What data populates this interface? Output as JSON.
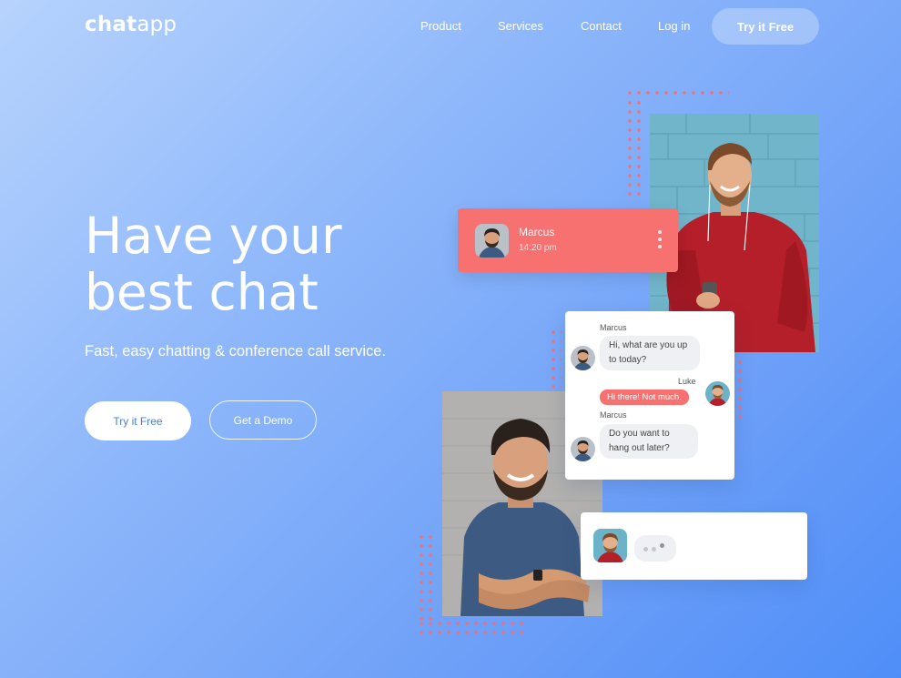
{
  "nav": {
    "logo_bold": "chat",
    "logo_light": "app",
    "links": [
      "Product",
      "Services",
      "Contact",
      "Log in"
    ],
    "cta_label": "Try it Free"
  },
  "hero": {
    "title_line1": "Have your",
    "title_line2": "best chat",
    "subtitle": "Fast, easy chatting & conference call service.",
    "primary_button": "Try it Free",
    "secondary_button": "Get a Demo"
  },
  "contact_card": {
    "name": "Marcus",
    "time": "14:20 pm"
  },
  "conversation": {
    "messages": [
      {
        "sender": "Marcus",
        "text_line1": "Hi, what are you up",
        "text_line2": "to today?"
      },
      {
        "sender": "Luke",
        "text": "Hi there! Not much."
      },
      {
        "sender": "Marcus",
        "text_line1": "Do you want to",
        "text_line2": "hang out later?"
      }
    ]
  },
  "colors": {
    "accent_red": "#f87171",
    "brand_blue": "#4a7fd6",
    "background_light": "#b7d3fd",
    "background_dark": "#4f8ef8"
  },
  "icons": [
    "more-vertical-icon",
    "typing-indicator-icon"
  ]
}
